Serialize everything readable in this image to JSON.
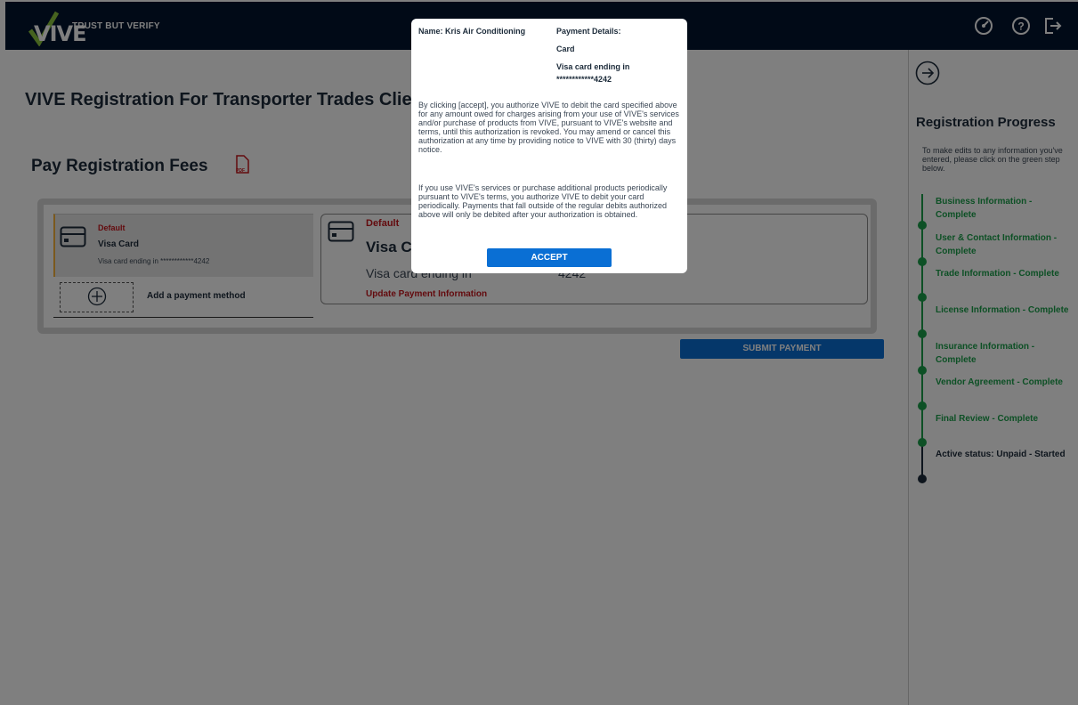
{
  "header": {
    "brand": "VIVE",
    "tagline": "TRUST BUT VERIFY",
    "icons": [
      "dashboard-icon",
      "help-icon",
      "logout-icon"
    ]
  },
  "main": {
    "page_title": "VIVE Registration For Transporter Trades Clie",
    "section_title": "Pay Registration Fees",
    "pdf_icon": "pdf-icon",
    "saved_card": {
      "default_label": "Default",
      "name": "Visa Card",
      "ending": "Visa card ending in ************4242"
    },
    "add_payment_label": "Add a payment method",
    "detail_card": {
      "default_label": "Default",
      "name": "Visa C",
      "ending": "Visa card ending in",
      "digits": "4242",
      "update_link": "Update Payment Information"
    },
    "submit_label": "SUBMIT PAYMENT"
  },
  "rail": {
    "title": "Registration Progress",
    "help": "To make edits to any information you've entered, please click on the green step below.",
    "steps": [
      {
        "label": "Business Information - Complete"
      },
      {
        "label": "User & Contact Information - Complete"
      },
      {
        "label": "Trade Information - Complete"
      },
      {
        "label": "License Information - Complete"
      },
      {
        "label": "Insurance Information - Complete"
      },
      {
        "label": "Vendor Agreement - Complete"
      },
      {
        "label": "Final Review - Complete"
      },
      {
        "label": "Active status: Unpaid - Started"
      }
    ]
  },
  "modal": {
    "name": "Name: Kris Air Conditioning",
    "payment_details_title": "Payment Details:",
    "payment_type": "Card",
    "card_ending": "Visa card ending in",
    "card_digits": "************4242",
    "paragraph1": "By clicking [accept], you authorize VIVE to debit the card specified above for any amount owed for charges arising from your use of VIVE's services and/or purchase of products from VIVE, pursuant to VIVE's website and terms, until this authorization is revoked. You may amend or cancel this authorization at any time by providing notice to VIVE with 30 (thirty) days notice.",
    "paragraph2": "If you use VIVE's services or purchase additional products periodically pursuant to VIVE's terms, you authorize VIVE to debit your card periodically. Payments that fall outside of the regular debits authorized above will only be debited after your authorization is obtained.",
    "accept_label": "ACCEPT"
  },
  "colors": {
    "header_bg": "#03142e",
    "primary_button": "#0a6fd4",
    "complete_green": "#1aa04a",
    "alert_red": "#c7161d"
  }
}
